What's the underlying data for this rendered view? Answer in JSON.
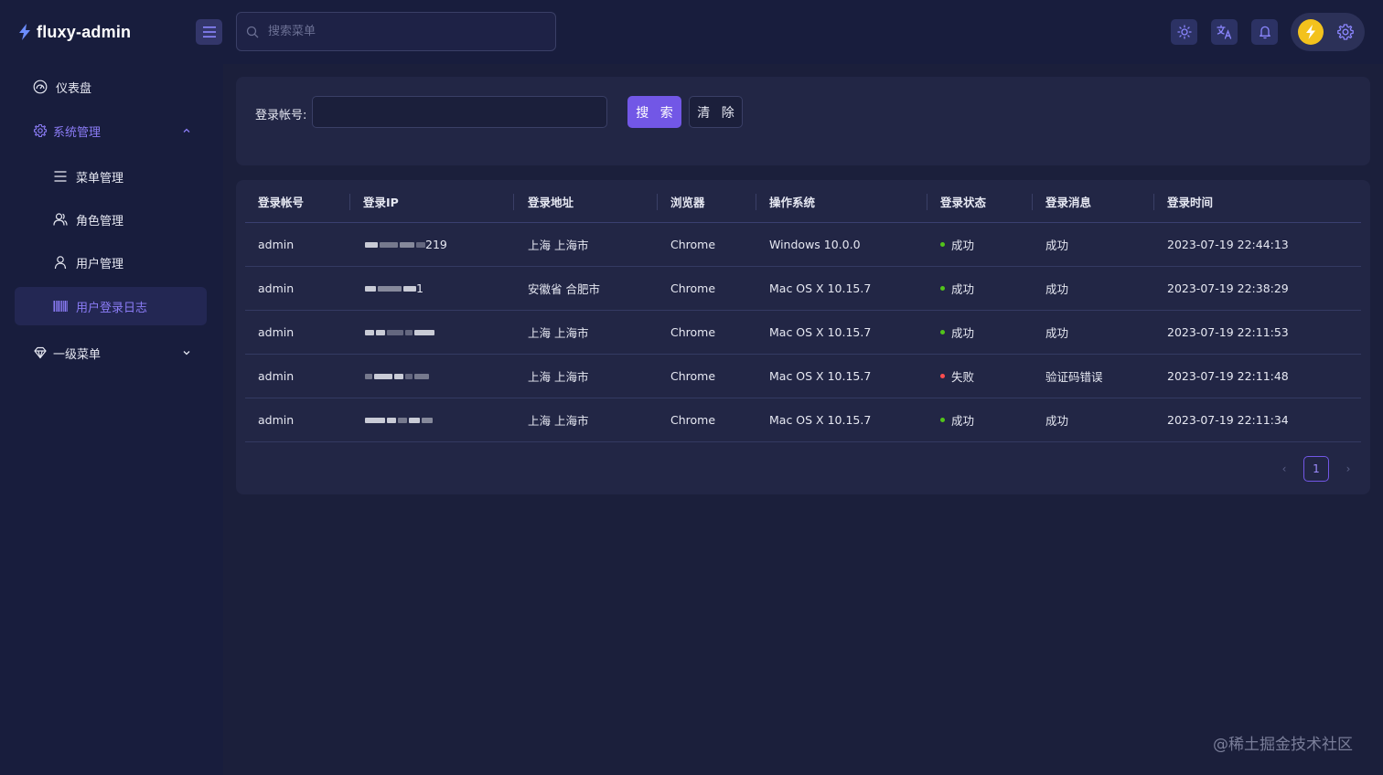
{
  "app": {
    "name": "fluxy-admin",
    "accent": "#7257e6",
    "status_success_color": "#52c41a",
    "status_fail_color": "#ff4d4f"
  },
  "header": {
    "search_placeholder": "搜索菜单",
    "icons": [
      "menu-toggle-icon",
      "search-icon",
      "sun-icon",
      "translate-icon",
      "bell-icon",
      "lightning-avatar-icon",
      "gear-icon"
    ]
  },
  "sidebar": {
    "items": [
      {
        "label": "仪表盘",
        "icon": "dashboard-icon"
      },
      {
        "label": "系统管理",
        "icon": "gear-icon",
        "expanded": true
      },
      {
        "label": "菜单管理",
        "icon": "list-icon"
      },
      {
        "label": "角色管理",
        "icon": "users-icon"
      },
      {
        "label": "用户管理",
        "icon": "user-icon"
      },
      {
        "label": "用户登录日志",
        "icon": "barcode-icon",
        "selected": true
      },
      {
        "label": "一级菜单",
        "icon": "gem-icon",
        "expanded": false
      }
    ]
  },
  "filter": {
    "account_label": "登录帐号:",
    "account_value": "",
    "search_label": "搜 索",
    "clear_label": "清 除"
  },
  "table": {
    "columns": [
      "登录帐号",
      "登录IP",
      "登录地址",
      "浏览器",
      "操作系统",
      "登录状态",
      "登录消息",
      "登录时间"
    ],
    "rows": [
      {
        "account": "admin",
        "ip": "219",
        "address": "上海 上海市",
        "browser": "Chrome",
        "os": "Windows 10.0.0",
        "status": "成功",
        "status_ok": true,
        "message": "成功",
        "time": "2023-07-19 22:44:13"
      },
      {
        "account": "admin",
        "ip": "1",
        "address": "安徽省 合肥市",
        "browser": "Chrome",
        "os": "Mac OS X 10.15.7",
        "status": "成功",
        "status_ok": true,
        "message": "成功",
        "time": "2023-07-19 22:38:29"
      },
      {
        "account": "admin",
        "ip": "",
        "address": "上海 上海市",
        "browser": "Chrome",
        "os": "Mac OS X 10.15.7",
        "status": "成功",
        "status_ok": true,
        "message": "成功",
        "time": "2023-07-19 22:11:53"
      },
      {
        "account": "admin",
        "ip": "",
        "address": "上海 上海市",
        "browser": "Chrome",
        "os": "Mac OS X 10.15.7",
        "status": "失败",
        "status_ok": false,
        "message": "验证码错误",
        "time": "2023-07-19 22:11:48"
      },
      {
        "account": "admin",
        "ip": "",
        "address": "上海 上海市",
        "browser": "Chrome",
        "os": "Mac OS X 10.15.7",
        "status": "成功",
        "status_ok": true,
        "message": "成功",
        "time": "2023-07-19 22:11:34"
      }
    ]
  },
  "pagination": {
    "current": "1",
    "prev": "‹",
    "next": "›"
  },
  "watermark": "@稀土掘金技术社区"
}
